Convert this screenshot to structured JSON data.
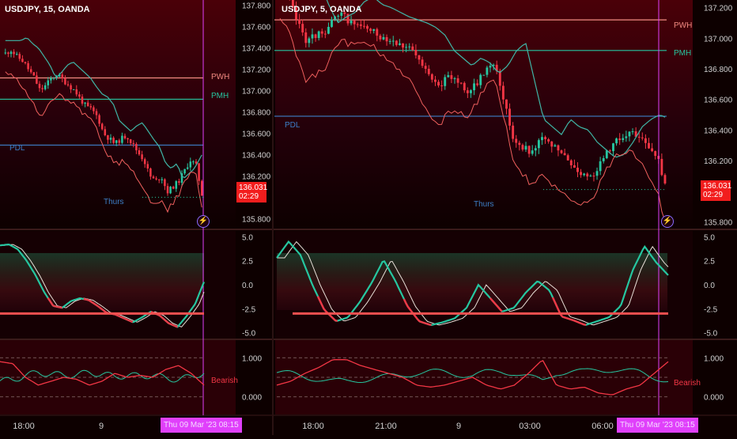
{
  "colors": {
    "background": "#0d0000",
    "bull_candle": "#26c6a0",
    "bear_candle": "#f23645",
    "pwh_line": "#f28b82",
    "pmh_line": "#26c6a0",
    "pdl_line": "#3d7fc8",
    "session_marker": "#e040fb",
    "price_badge": "#f21d1d"
  },
  "chart_data": [
    {
      "type": "candlestick",
      "panel": "left-price",
      "title": "USDJPY, 15, OANDA",
      "ylim": [
        135.7,
        137.85
      ],
      "yticks": [
        "137.800",
        "137.600",
        "137.400",
        "137.200",
        "137.000",
        "136.800",
        "136.600",
        "136.400",
        "136.200",
        "135.800"
      ],
      "levels": [
        {
          "label": "PWH",
          "value": 137.12
        },
        {
          "label": "PMH",
          "value": 136.92
        },
        {
          "label": "PDL",
          "value": 136.49
        }
      ],
      "marker": {
        "label": "Thurs"
      },
      "last_price": {
        "value": "136.031",
        "countdown": "02:29"
      },
      "close_path": [
        137.35,
        137.38,
        137.32,
        137.28,
        137.2,
        137.12,
        137.0,
        137.05,
        137.12,
        137.15,
        137.1,
        137.05,
        137.0,
        136.92,
        136.85,
        136.82,
        136.75,
        136.6,
        136.55,
        136.5,
        136.55,
        136.58,
        136.5,
        136.42,
        136.35,
        136.2,
        136.15,
        136.2,
        136.05,
        136.1,
        136.15,
        136.25,
        136.35,
        136.3,
        136.03
      ]
    },
    {
      "type": "candlestick",
      "panel": "right-price",
      "title": "USDJPY, 5, OANDA",
      "ylim": [
        135.75,
        137.25
      ],
      "yticks": [
        "137.200",
        "137.000",
        "136.800",
        "136.600",
        "136.400",
        "136.200",
        "135.800"
      ],
      "levels": [
        {
          "label": "PWH",
          "value": 137.12
        },
        {
          "label": "PMH",
          "value": 136.92
        },
        {
          "label": "PDL",
          "value": 136.49
        }
      ],
      "marker": {
        "label": "Thurs"
      },
      "last_price": {
        "value": "136.031",
        "countdown": "02:29"
      },
      "close_path": [
        137.3,
        137.25,
        137.1,
        136.98,
        137.02,
        137.05,
        137.12,
        137.15,
        137.1,
        137.08,
        137.05,
        137.02,
        137.0,
        136.98,
        136.95,
        136.9,
        136.8,
        136.75,
        136.7,
        136.75,
        136.72,
        136.65,
        136.7,
        136.8,
        136.85,
        136.6,
        136.35,
        136.3,
        136.25,
        136.35,
        136.3,
        136.28,
        136.2,
        136.15,
        136.1,
        136.12,
        136.2,
        136.3,
        136.35,
        136.38,
        136.35,
        136.3,
        136.25,
        136.03
      ]
    },
    {
      "type": "line",
      "panel": "oscillator",
      "ylim": [
        -5.6,
        5.6
      ],
      "yticks": [
        "5.0",
        "2.5",
        "0.0",
        "-2.5",
        "-5.0"
      ],
      "threshold": -3.0,
      "left_series": [
        4.1,
        4.2,
        3.7,
        2.5,
        1.0,
        -0.8,
        -2.2,
        -2.4,
        -1.7,
        -1.4,
        -1.6,
        -2.2,
        -2.9,
        -3.1,
        -3.5,
        -3.9,
        -3.4,
        -2.8,
        -3.2,
        -4.0,
        -4.4,
        -3.3,
        -2.0,
        0.3
      ],
      "right_series": [
        2.8,
        4.5,
        3.1,
        0.0,
        -2.6,
        -3.8,
        -3.4,
        -1.8,
        0.2,
        2.6,
        0.4,
        -2.2,
        -3.8,
        -4.2,
        -3.9,
        -3.5,
        -2.4,
        0.0,
        -1.4,
        -2.8,
        -2.4,
        -0.8,
        0.4,
        -0.6,
        -3.3,
        -3.7,
        -4.2,
        -3.8,
        -3.4,
        -2.2,
        1.5,
        4.0,
        2.3,
        1.0
      ]
    },
    {
      "type": "line",
      "panel": "bias",
      "ylim": [
        -0.45,
        1.45
      ],
      "yticks": [
        "1.000",
        "0.000"
      ],
      "status": "Bearish",
      "left_series": [
        0.9,
        0.85,
        0.5,
        0.3,
        0.4,
        0.5,
        0.45,
        0.3,
        0.4,
        0.6,
        0.5,
        0.55,
        0.5,
        0.7,
        0.8,
        0.6,
        0.3
      ],
      "right_series": [
        0.3,
        0.4,
        0.6,
        0.75,
        0.95,
        0.95,
        0.8,
        0.7,
        0.6,
        0.5,
        0.3,
        0.25,
        0.3,
        0.4,
        0.5,
        0.3,
        0.2,
        0.3,
        0.6,
        0.95,
        0.3,
        0.2,
        0.25,
        0.1,
        0.05,
        0.2,
        0.3,
        0.6,
        0.9
      ]
    }
  ],
  "time_axis": {
    "left_ticks": [
      "18:00",
      "9"
    ],
    "right_ticks": [
      "18:00",
      "21:00",
      "9",
      "03:00",
      "06:00"
    ],
    "cursor_label": "Thu 09 Mar '23  08:15"
  }
}
